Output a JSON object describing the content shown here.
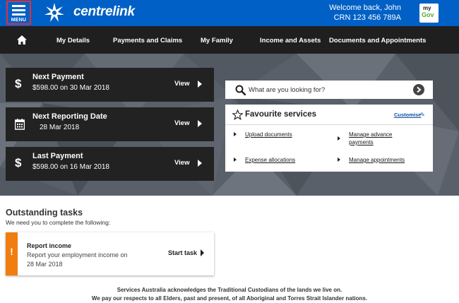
{
  "header": {
    "menu_label": "MENU",
    "brand_name": "centrelink",
    "welcome_text": "Welcome back, John",
    "crn_text": "CRN 123 456 789A",
    "mygov_top": "my",
    "mygov_bottom": "Gov",
    "brand_color": "#0060c5"
  },
  "nav": {
    "home_icon": "home-icon",
    "items": [
      {
        "label": "My Details"
      },
      {
        "label": "Payments and Claims"
      },
      {
        "label": "My Family"
      },
      {
        "label": "Income and Assets"
      },
      {
        "label": "Documents and Appointments"
      }
    ]
  },
  "payments": [
    {
      "icon": "dollar-icon",
      "title": "Next Payment",
      "amount": "$598.00",
      "on_label": "on",
      "date": "30 Mar 2018",
      "view_label": "View"
    },
    {
      "icon": "calendar-icon",
      "title": "Next Reporting Date",
      "amount": "",
      "on_label": "",
      "date": "28 Mar 2018",
      "view_label": "View"
    },
    {
      "icon": "dollar-icon",
      "title": "Last Payment",
      "amount": "$598.00",
      "on_label": "on",
      "date": "16 Mar 2018",
      "view_label": "View"
    }
  ],
  "search": {
    "placeholder": "What are you looking for?"
  },
  "favourites": {
    "title": "Favourite services",
    "customise_label": "Customise",
    "links": [
      {
        "label": "Upload documents"
      },
      {
        "label": "Manage advance payments"
      },
      {
        "label": "Expense allocations"
      },
      {
        "label": "Manage appointments"
      }
    ]
  },
  "tasks": {
    "title": "Outstanding tasks",
    "subtitle": "We need you to complete the following:",
    "items": [
      {
        "title": "Report income",
        "description": "Report your employment income on",
        "date": "28 Mar 2018",
        "action_label": "Start task",
        "accent_color": "#ef7d0f"
      }
    ]
  },
  "acknowledgement": {
    "line1": "Services Australia acknowledges the Traditional Custodians of the lands we live on.",
    "line2": "We pay our respects to all Elders, past and present, of all Aboriginal and Torres Strait Islander nations."
  }
}
